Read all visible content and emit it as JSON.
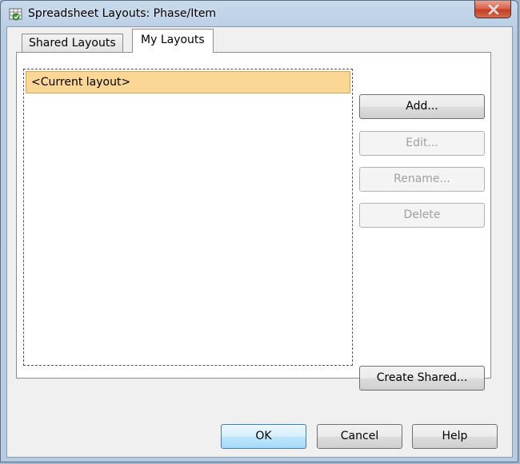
{
  "window": {
    "title": "Spreadsheet Layouts: Phase/Item",
    "icon": "spreadsheet-app-icon",
    "close_icon": "close-icon"
  },
  "tabs": [
    {
      "label": "Shared Layouts",
      "selected": false
    },
    {
      "label": "My Layouts",
      "selected": true
    }
  ],
  "layouts_list": {
    "items": [
      {
        "label": "<Current layout>",
        "selected": true
      }
    ]
  },
  "side_buttons": {
    "add": {
      "label": "Add...",
      "enabled": true
    },
    "edit": {
      "label": "Edit...",
      "enabled": false
    },
    "rename": {
      "label": "Rename...",
      "enabled": false
    },
    "delete": {
      "label": "Delete",
      "enabled": false
    },
    "create_shared": {
      "label": "Create Shared...",
      "enabled": true
    }
  },
  "footer_buttons": {
    "ok": {
      "label": "OK"
    },
    "cancel": {
      "label": "Cancel"
    },
    "help": {
      "label": "Help"
    }
  },
  "colors": {
    "selection_fill": "#fbd694",
    "selection_border": "#d7a54d",
    "close_button": "#c23f22",
    "default_button_border": "#3c7fb1"
  }
}
